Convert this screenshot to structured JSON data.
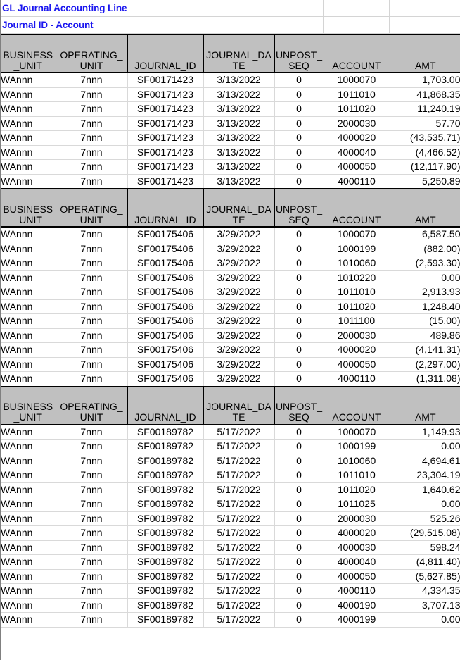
{
  "report": {
    "title_line_1": "GL Journal Accounting Line",
    "title_line_2": "Journal ID - Account",
    "title_color": "#1a16ef",
    "header_bg": "#c0c0c0"
  },
  "columns": [
    {
      "key": "business_unit",
      "label": "BUSINESS_UNIT"
    },
    {
      "key": "operating_unit",
      "label": "OPERATING_UNIT"
    },
    {
      "key": "journal_id",
      "label": "JOURNAL_ID"
    },
    {
      "key": "journal_date",
      "label": "JOURNAL_DATE"
    },
    {
      "key": "unpost_seq",
      "label": "UNPOST_SEQ"
    },
    {
      "key": "account",
      "label": "ACCOUNT"
    },
    {
      "key": "amt",
      "label": "AMT"
    }
  ],
  "blocks": [
    {
      "journal_id": "SF00171423",
      "journal_date": "3/13/2022",
      "rows": [
        {
          "business_unit": "WAnnn",
          "operating_unit": "7nnn",
          "journal_id": "SF00171423",
          "journal_date": "3/13/2022",
          "unpost_seq": "0",
          "account": "1000070",
          "amt": "1,703.00"
        },
        {
          "business_unit": "WAnnn",
          "operating_unit": "7nnn",
          "journal_id": "SF00171423",
          "journal_date": "3/13/2022",
          "unpost_seq": "0",
          "account": "1011010",
          "amt": "41,868.35"
        },
        {
          "business_unit": "WAnnn",
          "operating_unit": "7nnn",
          "journal_id": "SF00171423",
          "journal_date": "3/13/2022",
          "unpost_seq": "0",
          "account": "1011020",
          "amt": "11,240.19"
        },
        {
          "business_unit": "WAnnn",
          "operating_unit": "7nnn",
          "journal_id": "SF00171423",
          "journal_date": "3/13/2022",
          "unpost_seq": "0",
          "account": "2000030",
          "amt": "57.70"
        },
        {
          "business_unit": "WAnnn",
          "operating_unit": "7nnn",
          "journal_id": "SF00171423",
          "journal_date": "3/13/2022",
          "unpost_seq": "0",
          "account": "4000020",
          "amt": "(43,535.71)"
        },
        {
          "business_unit": "WAnnn",
          "operating_unit": "7nnn",
          "journal_id": "SF00171423",
          "journal_date": "3/13/2022",
          "unpost_seq": "0",
          "account": "4000040",
          "amt": "(4,466.52)"
        },
        {
          "business_unit": "WAnnn",
          "operating_unit": "7nnn",
          "journal_id": "SF00171423",
          "journal_date": "3/13/2022",
          "unpost_seq": "0",
          "account": "4000050",
          "amt": "(12,117.90)"
        },
        {
          "business_unit": "WAnnn",
          "operating_unit": "7nnn",
          "journal_id": "SF00171423",
          "journal_date": "3/13/2022",
          "unpost_seq": "0",
          "account": "4000110",
          "amt": "5,250.89"
        }
      ]
    },
    {
      "journal_id": "SF00175406",
      "journal_date": "3/29/2022",
      "rows": [
        {
          "business_unit": "WAnnn",
          "operating_unit": "7nnn",
          "journal_id": "SF00175406",
          "journal_date": "3/29/2022",
          "unpost_seq": "0",
          "account": "1000070",
          "amt": "6,587.50"
        },
        {
          "business_unit": "WAnnn",
          "operating_unit": "7nnn",
          "journal_id": "SF00175406",
          "journal_date": "3/29/2022",
          "unpost_seq": "0",
          "account": "1000199",
          "amt": "(882.00)"
        },
        {
          "business_unit": "WAnnn",
          "operating_unit": "7nnn",
          "journal_id": "SF00175406",
          "journal_date": "3/29/2022",
          "unpost_seq": "0",
          "account": "1010060",
          "amt": "(2,593.30)"
        },
        {
          "business_unit": "WAnnn",
          "operating_unit": "7nnn",
          "journal_id": "SF00175406",
          "journal_date": "3/29/2022",
          "unpost_seq": "0",
          "account": "1010220",
          "amt": "0.00"
        },
        {
          "business_unit": "WAnnn",
          "operating_unit": "7nnn",
          "journal_id": "SF00175406",
          "journal_date": "3/29/2022",
          "unpost_seq": "0",
          "account": "1011010",
          "amt": "2,913.93"
        },
        {
          "business_unit": "WAnnn",
          "operating_unit": "7nnn",
          "journal_id": "SF00175406",
          "journal_date": "3/29/2022",
          "unpost_seq": "0",
          "account": "1011020",
          "amt": "1,248.40"
        },
        {
          "business_unit": "WAnnn",
          "operating_unit": "7nnn",
          "journal_id": "SF00175406",
          "journal_date": "3/29/2022",
          "unpost_seq": "0",
          "account": "1011100",
          "amt": "(15.00)"
        },
        {
          "business_unit": "WAnnn",
          "operating_unit": "7nnn",
          "journal_id": "SF00175406",
          "journal_date": "3/29/2022",
          "unpost_seq": "0",
          "account": "2000030",
          "amt": "489.86"
        },
        {
          "business_unit": "WAnnn",
          "operating_unit": "7nnn",
          "journal_id": "SF00175406",
          "journal_date": "3/29/2022",
          "unpost_seq": "0",
          "account": "4000020",
          "amt": "(4,141.31)"
        },
        {
          "business_unit": "WAnnn",
          "operating_unit": "7nnn",
          "journal_id": "SF00175406",
          "journal_date": "3/29/2022",
          "unpost_seq": "0",
          "account": "4000050",
          "amt": "(2,297.00)"
        },
        {
          "business_unit": "WAnnn",
          "operating_unit": "7nnn",
          "journal_id": "SF00175406",
          "journal_date": "3/29/2022",
          "unpost_seq": "0",
          "account": "4000110",
          "amt": "(1,311.08)"
        }
      ]
    },
    {
      "journal_id": "SF00189782",
      "journal_date": "5/17/2022",
      "rows": [
        {
          "business_unit": "WAnnn",
          "operating_unit": "7nnn",
          "journal_id": "SF00189782",
          "journal_date": "5/17/2022",
          "unpost_seq": "0",
          "account": "1000070",
          "amt": "1,149.93"
        },
        {
          "business_unit": "WAnnn",
          "operating_unit": "7nnn",
          "journal_id": "SF00189782",
          "journal_date": "5/17/2022",
          "unpost_seq": "0",
          "account": "1000199",
          "amt": "0.00"
        },
        {
          "business_unit": "WAnnn",
          "operating_unit": "7nnn",
          "journal_id": "SF00189782",
          "journal_date": "5/17/2022",
          "unpost_seq": "0",
          "account": "1010060",
          "amt": "4,694.61"
        },
        {
          "business_unit": "WAnnn",
          "operating_unit": "7nnn",
          "journal_id": "SF00189782",
          "journal_date": "5/17/2022",
          "unpost_seq": "0",
          "account": "1011010",
          "amt": "23,304.19"
        },
        {
          "business_unit": "WAnnn",
          "operating_unit": "7nnn",
          "journal_id": "SF00189782",
          "journal_date": "5/17/2022",
          "unpost_seq": "0",
          "account": "1011020",
          "amt": "1,640.62"
        },
        {
          "business_unit": "WAnnn",
          "operating_unit": "7nnn",
          "journal_id": "SF00189782",
          "journal_date": "5/17/2022",
          "unpost_seq": "0",
          "account": "1011025",
          "amt": "0.00"
        },
        {
          "business_unit": "WAnnn",
          "operating_unit": "7nnn",
          "journal_id": "SF00189782",
          "journal_date": "5/17/2022",
          "unpost_seq": "0",
          "account": "2000030",
          "amt": "525.26"
        },
        {
          "business_unit": "WAnnn",
          "operating_unit": "7nnn",
          "journal_id": "SF00189782",
          "journal_date": "5/17/2022",
          "unpost_seq": "0",
          "account": "4000020",
          "amt": "(29,515.08)"
        },
        {
          "business_unit": "WAnnn",
          "operating_unit": "7nnn",
          "journal_id": "SF00189782",
          "journal_date": "5/17/2022",
          "unpost_seq": "0",
          "account": "4000030",
          "amt": "598.24"
        },
        {
          "business_unit": "WAnnn",
          "operating_unit": "7nnn",
          "journal_id": "SF00189782",
          "journal_date": "5/17/2022",
          "unpost_seq": "0",
          "account": "4000040",
          "amt": "(4,811.40)"
        },
        {
          "business_unit": "WAnnn",
          "operating_unit": "7nnn",
          "journal_id": "SF00189782",
          "journal_date": "5/17/2022",
          "unpost_seq": "0",
          "account": "4000050",
          "amt": "(5,627.85)"
        },
        {
          "business_unit": "WAnnn",
          "operating_unit": "7nnn",
          "journal_id": "SF00189782",
          "journal_date": "5/17/2022",
          "unpost_seq": "0",
          "account": "4000110",
          "amt": "4,334.35"
        },
        {
          "business_unit": "WAnnn",
          "operating_unit": "7nnn",
          "journal_id": "SF00189782",
          "journal_date": "5/17/2022",
          "unpost_seq": "0",
          "account": "4000190",
          "amt": "3,707.13"
        },
        {
          "business_unit": "WAnnn",
          "operating_unit": "7nnn",
          "journal_id": "SF00189782",
          "journal_date": "5/17/2022",
          "unpost_seq": "0",
          "account": "4000199",
          "amt": "0.00"
        }
      ]
    }
  ]
}
